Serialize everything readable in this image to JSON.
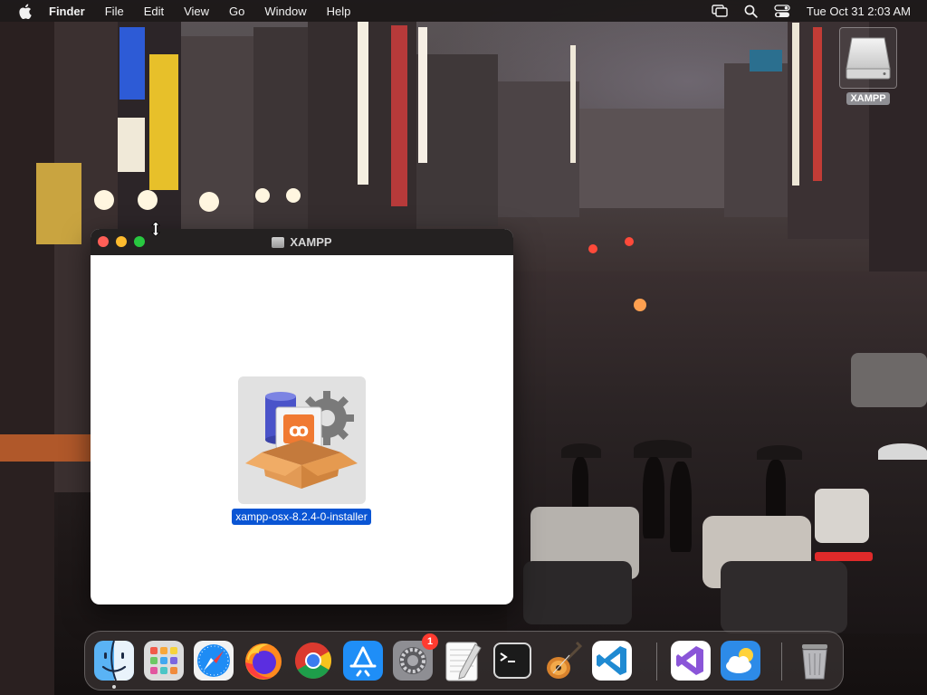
{
  "menubar": {
    "app_name": "Finder",
    "items": [
      "File",
      "Edit",
      "View",
      "Go",
      "Window",
      "Help"
    ],
    "clock": "Tue Oct 31  2:03 AM",
    "status_icons": [
      "screen-mirroring-icon",
      "spotlight-search-icon",
      "control-center-icon"
    ]
  },
  "desktop": {
    "volume_label": "XAMPP"
  },
  "window": {
    "title": "XAMPP",
    "file": {
      "name": "xampp-osx-8.2.4-0-installer",
      "selected": true
    }
  },
  "dock": {
    "apps": [
      {
        "name": "Finder",
        "icon": "finder-icon",
        "running": true
      },
      {
        "name": "Launchpad",
        "icon": "launchpad-icon"
      },
      {
        "name": "Safari",
        "icon": "safari-icon"
      },
      {
        "name": "Firefox",
        "icon": "firefox-icon"
      },
      {
        "name": "Chrome",
        "icon": "chrome-icon"
      },
      {
        "name": "App Store",
        "icon": "app-store-icon"
      },
      {
        "name": "System Settings",
        "icon": "system-settings-icon",
        "badge": "1"
      },
      {
        "name": "TextEdit",
        "icon": "textedit-icon"
      },
      {
        "name": "Terminal",
        "icon": "terminal-icon"
      },
      {
        "name": "Instruments",
        "icon": "instruments-icon"
      },
      {
        "name": "Visual Studio Code",
        "icon": "vscode-icon"
      },
      {
        "name": "Visual Studio",
        "icon": "visual-studio-icon"
      },
      {
        "name": "Weather",
        "icon": "weather-icon"
      },
      {
        "name": "Trash",
        "icon": "trash-icon"
      }
    ]
  },
  "colors": {
    "selection": "#0a55d4",
    "close": "#ff5f57",
    "minimize": "#febc2e",
    "zoom": "#28c840",
    "badge": "#ff3b30"
  }
}
